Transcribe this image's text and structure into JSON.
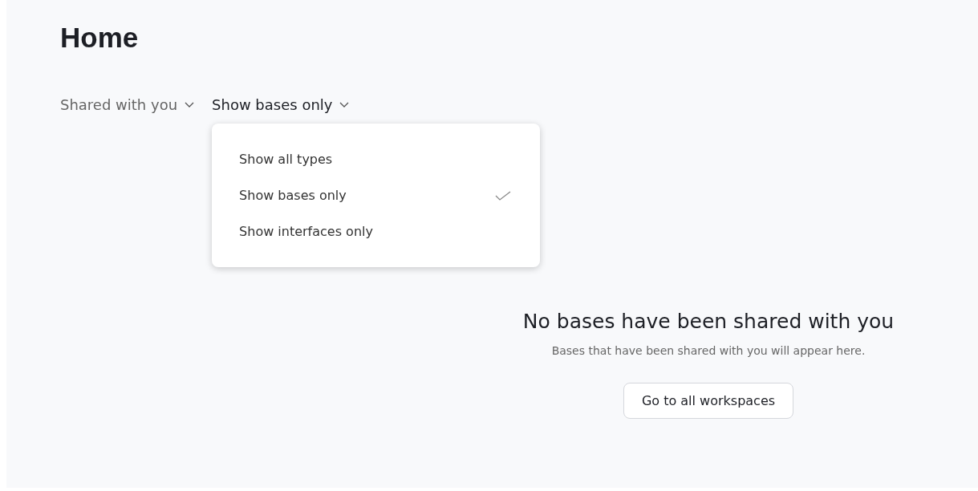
{
  "page": {
    "title": "Home"
  },
  "filters": [
    {
      "label": "Shared with you",
      "expanded": false
    },
    {
      "label": "Show bases only",
      "expanded": true
    }
  ],
  "menu": {
    "items": [
      {
        "label": "Show all types",
        "selected": false
      },
      {
        "label": "Show bases only",
        "selected": true
      },
      {
        "label": "Show interfaces only",
        "selected": false
      }
    ]
  },
  "empty_state": {
    "heading": "No bases have been shared with you",
    "message": "Bases that have been shared with you will appear here.",
    "button": "Go to all workspaces"
  }
}
